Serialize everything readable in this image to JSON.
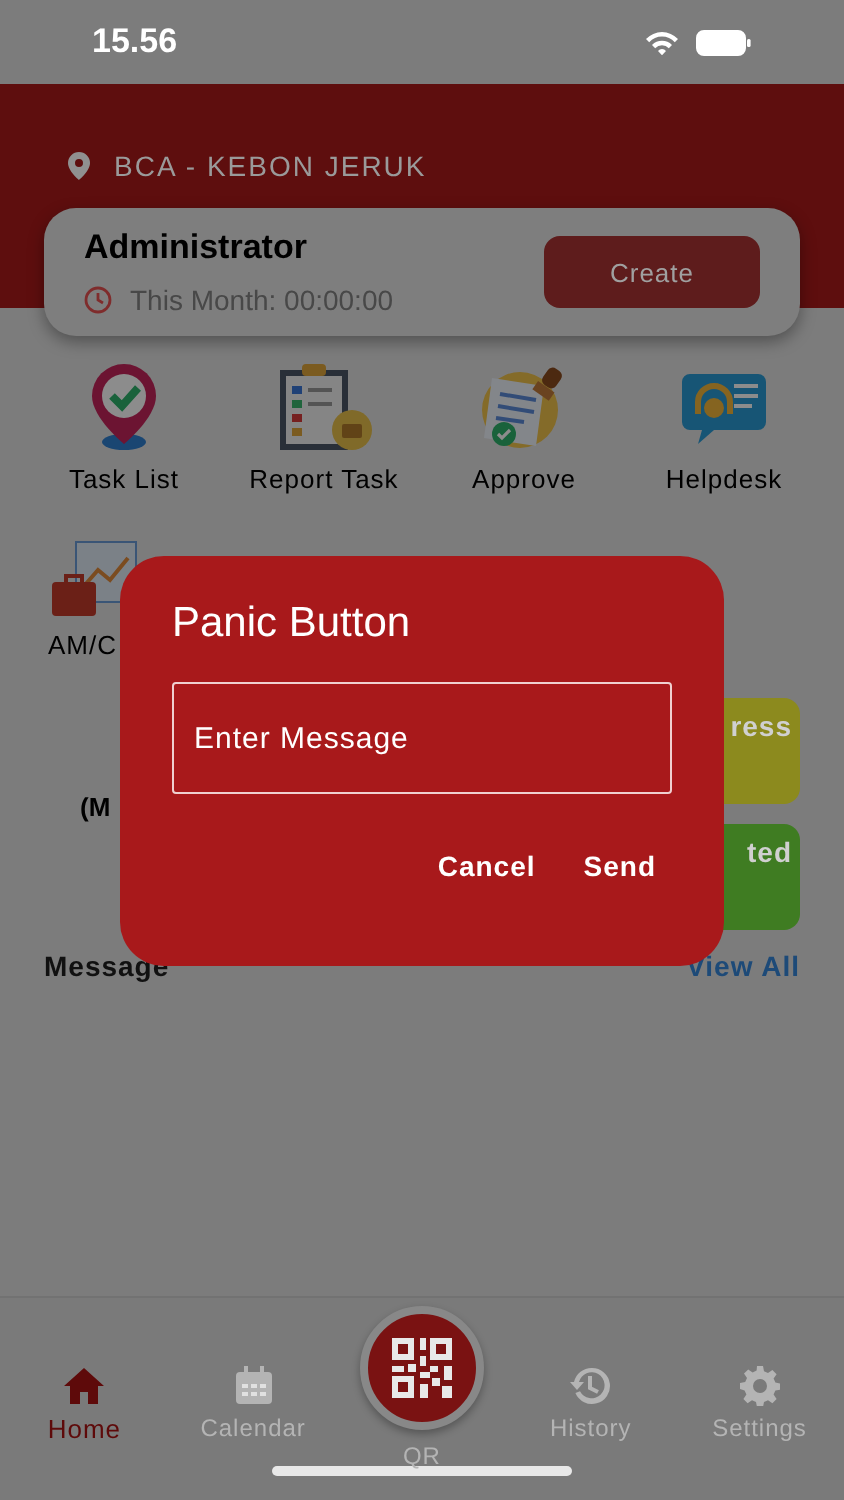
{
  "status_bar": {
    "time": "15.56"
  },
  "header": {
    "location": "BCA - KEBON JERUK"
  },
  "user_card": {
    "name": "Administrator",
    "period": "This Month: 00:00:00",
    "button": "Create"
  },
  "menu": [
    {
      "label": "Task List",
      "kind": "pin"
    },
    {
      "label": "Report Task",
      "kind": "clipboard"
    },
    {
      "label": "Approve",
      "kind": "stamp"
    },
    {
      "label": "Helpdesk",
      "kind": "chat"
    }
  ],
  "menu_row_2": [
    {
      "label": "AM/C",
      "kind": "briefcase"
    }
  ],
  "summary_label": "(M",
  "status_tiles": [
    {
      "label": "ress",
      "color": "#8c8a1e"
    },
    {
      "label": "ted",
      "color": "#3f7c22"
    }
  ],
  "messages": {
    "title": "Message",
    "link": "View All"
  },
  "nav": [
    {
      "label": "Home",
      "kind": "home",
      "selected": true
    },
    {
      "label": "Calendar",
      "kind": "calendar",
      "selected": false
    },
    {
      "label": "QR",
      "kind": "qr",
      "selected": false
    },
    {
      "label": "History",
      "kind": "history",
      "selected": false
    },
    {
      "label": "Settings",
      "kind": "settings",
      "selected": false
    }
  ],
  "dialog": {
    "title": "Panic Button",
    "placeholder": "Enter Message",
    "buttons": [
      "Cancel",
      "Send"
    ]
  }
}
